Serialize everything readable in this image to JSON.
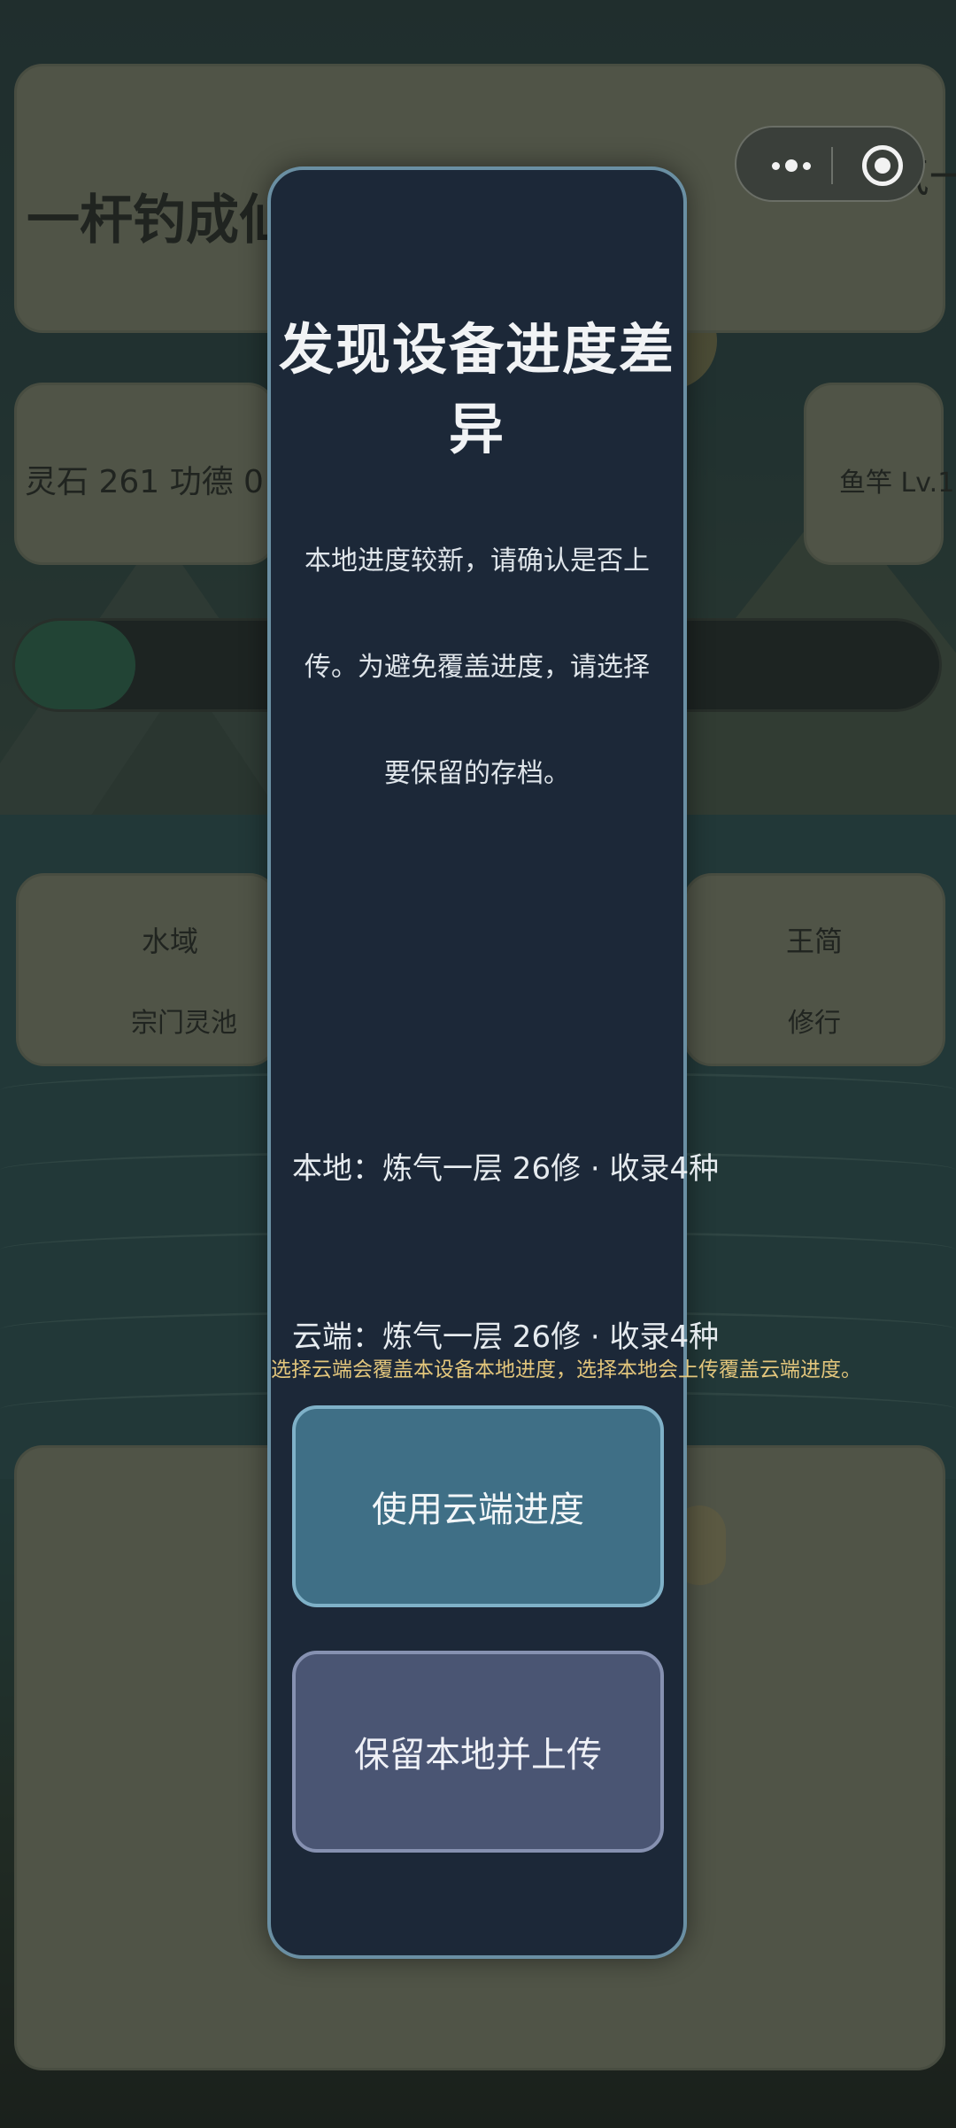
{
  "game": {
    "title": "一杆钓成仙",
    "realm_label": "[炼气一层",
    "resources": "灵石 261 功德 0",
    "rod_level": "鱼竿 Lv.1",
    "left_card": {
      "line1": "水域",
      "line2": "宗门灵池"
    },
    "right_card": {
      "line1": "王简",
      "line2": "修行"
    },
    "progress_fraction": 0.13
  },
  "capsule": {
    "more_icon": "more-dots-icon",
    "close_icon": "target-close-icon"
  },
  "modal": {
    "title": "发现设备进度差异",
    "description": "本地进度较新，请确认是否上传。为避免覆盖进度，请选择要保留的存档。",
    "local_progress": "本地：炼气一层 26修 · 收录4种",
    "cloud_progress": "云端：炼气一层 26修 · 收录4种",
    "hint": "选择云端会覆盖本设备本地进度，选择本地会上传覆盖云端进度。",
    "use_cloud_label": "使用云端进度",
    "keep_local_label": "保留本地并上传"
  },
  "colors": {
    "modal_bg": "#1c2838",
    "modal_border": "#6a8fa3",
    "cloud_button": "#3f6f86",
    "local_button": "#4a5573",
    "hint_text": "#e3c67c"
  }
}
